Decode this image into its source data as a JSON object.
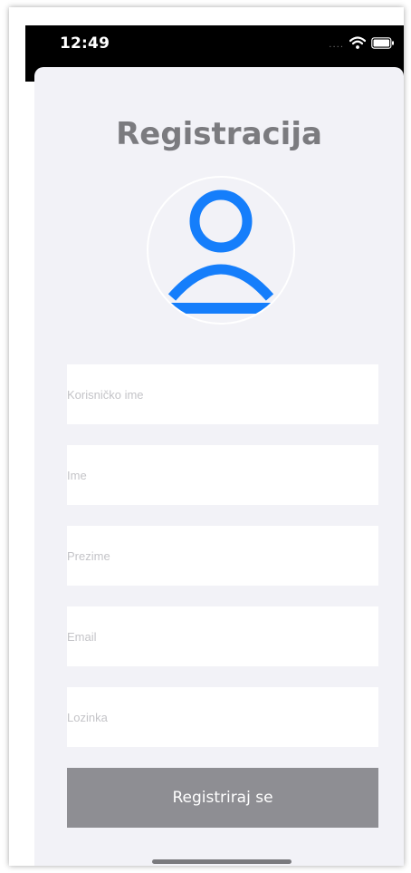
{
  "status_bar": {
    "time": "12:49",
    "signal_dots": "....",
    "wifi_icon": "wifi-icon",
    "battery_icon": "battery-icon"
  },
  "page": {
    "title": "Registracija",
    "avatar_icon": "person-icon",
    "accent_color": "#157efb"
  },
  "form": {
    "fields": [
      {
        "placeholder": "Korisničko ime",
        "value": ""
      },
      {
        "placeholder": "Ime",
        "value": ""
      },
      {
        "placeholder": "Prezime",
        "value": ""
      },
      {
        "placeholder": "Email",
        "value": ""
      },
      {
        "placeholder": "Lozinka",
        "value": ""
      }
    ],
    "submit_label": "Registriraj se",
    "submit_color": "#8e8e93"
  }
}
